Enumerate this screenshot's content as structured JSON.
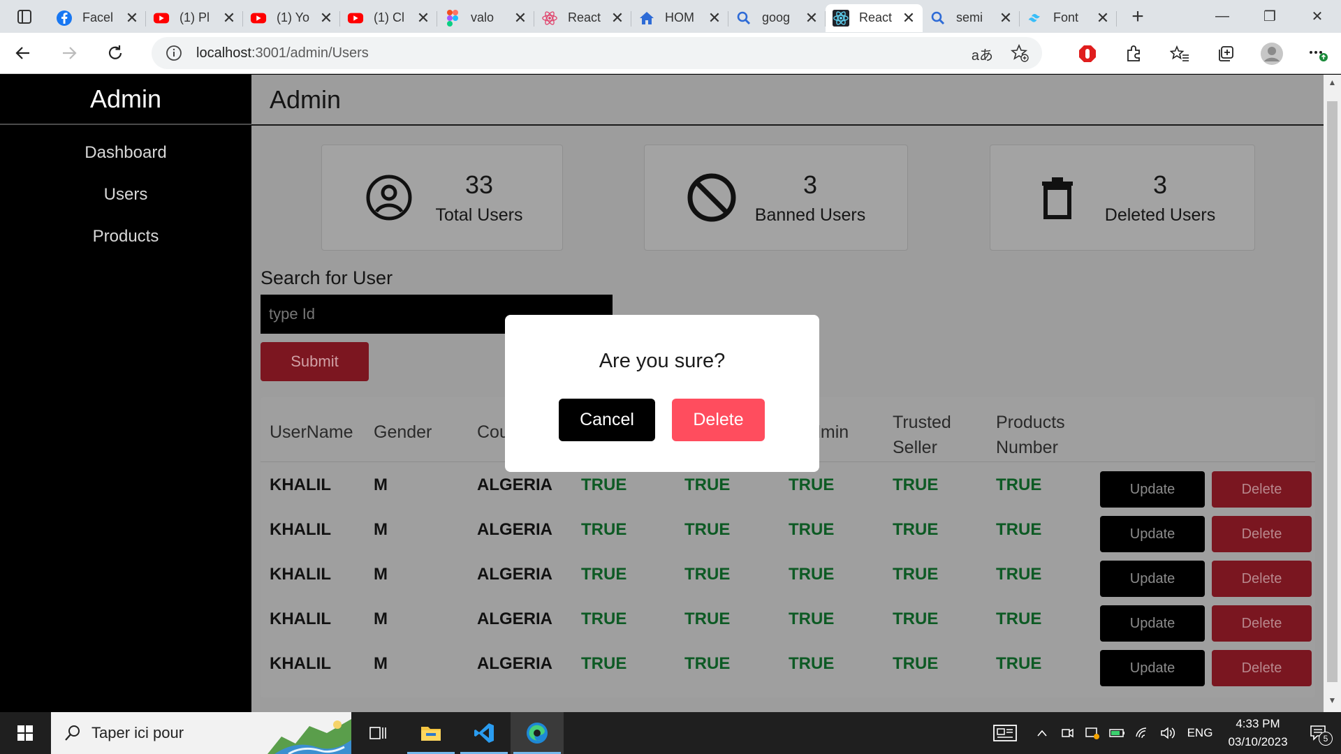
{
  "browser": {
    "tabs": [
      {
        "title": "Facel",
        "icon": "facebook-icon",
        "color": "#1877f2"
      },
      {
        "title": "(1) Pl",
        "icon": "youtube-icon",
        "color": "#ff0000"
      },
      {
        "title": "(1) Yo",
        "icon": "youtube-icon",
        "color": "#ff0000"
      },
      {
        "title": "(1) Cl",
        "icon": "youtube-icon",
        "color": "#ff0000"
      },
      {
        "title": "valo",
        "icon": "figma-icon",
        "color": "#f24e1e"
      },
      {
        "title": "React",
        "icon": "react-icon",
        "color": "#e0416a"
      },
      {
        "title": "HOM",
        "icon": "home-icon",
        "color": "#2e6bd6"
      },
      {
        "title": "goog",
        "icon": "search-icon",
        "color": "#2e6bd6"
      },
      {
        "title": "React",
        "icon": "react-icon",
        "color": "#20232a",
        "active": true
      },
      {
        "title": "semi",
        "icon": "search-icon",
        "color": "#2e6bd6"
      },
      {
        "title": "Font",
        "icon": "tailwind-icon",
        "color": "#38bdf8"
      }
    ],
    "url_host": "localhost",
    "url_path": ":3001/admin/Users"
  },
  "sidebar": {
    "title": "Admin",
    "items": [
      "Dashboard",
      "Users",
      "Products"
    ]
  },
  "header": {
    "title": "Admin"
  },
  "stats": {
    "total": {
      "value": "33",
      "label": "Total Users",
      "icon": "user-circle-icon"
    },
    "banned": {
      "value": "3",
      "label": "Banned Users",
      "icon": "ban-icon"
    },
    "deleted": {
      "value": "3",
      "label": "Deleted Users",
      "icon": "trash-icon"
    }
  },
  "search": {
    "label": "Search for User",
    "placeholder": "type Id",
    "submit": "Submit"
  },
  "table": {
    "headers": [
      "UserName",
      "Gender",
      "Cou",
      "",
      "",
      "dmin",
      "Trusted Seller",
      "Products Number"
    ],
    "rows": [
      {
        "username": "KHALIL",
        "gender": "M",
        "country": "ALGERIA",
        "c4": "TRUE",
        "c5": "TRUE",
        "c6": "TRUE",
        "c7": "TRUE",
        "c8": "TRUE",
        "update": "Update",
        "delete": "Delete"
      },
      {
        "username": "KHALIL",
        "gender": "M",
        "country": "ALGERIA",
        "c4": "TRUE",
        "c5": "TRUE",
        "c6": "TRUE",
        "c7": "TRUE",
        "c8": "TRUE",
        "update": "Update",
        "delete": "Delete"
      },
      {
        "username": "KHALIL",
        "gender": "M",
        "country": "ALGERIA",
        "c4": "TRUE",
        "c5": "TRUE",
        "c6": "TRUE",
        "c7": "TRUE",
        "c8": "TRUE",
        "update": "Update",
        "delete": "Delete"
      },
      {
        "username": "KHALIL",
        "gender": "M",
        "country": "ALGERIA",
        "c4": "TRUE",
        "c5": "TRUE",
        "c6": "TRUE",
        "c7": "TRUE",
        "c8": "TRUE",
        "update": "Update",
        "delete": "Delete"
      },
      {
        "username": "KHALIL",
        "gender": "M",
        "country": "ALGERIA",
        "c4": "TRUE",
        "c5": "TRUE",
        "c6": "TRUE",
        "c7": "TRUE",
        "c8": "TRUE",
        "update": "Update",
        "delete": "Delete"
      }
    ]
  },
  "modal": {
    "title": "Are you sure?",
    "cancel": "Cancel",
    "delete": "Delete",
    "delete_color": "#ff4d5e"
  },
  "taskbar": {
    "search_text": "Taper ici pour",
    "language": "ENG",
    "time": "4:33 PM",
    "date": "03/10/2023",
    "notification_count": "5"
  }
}
